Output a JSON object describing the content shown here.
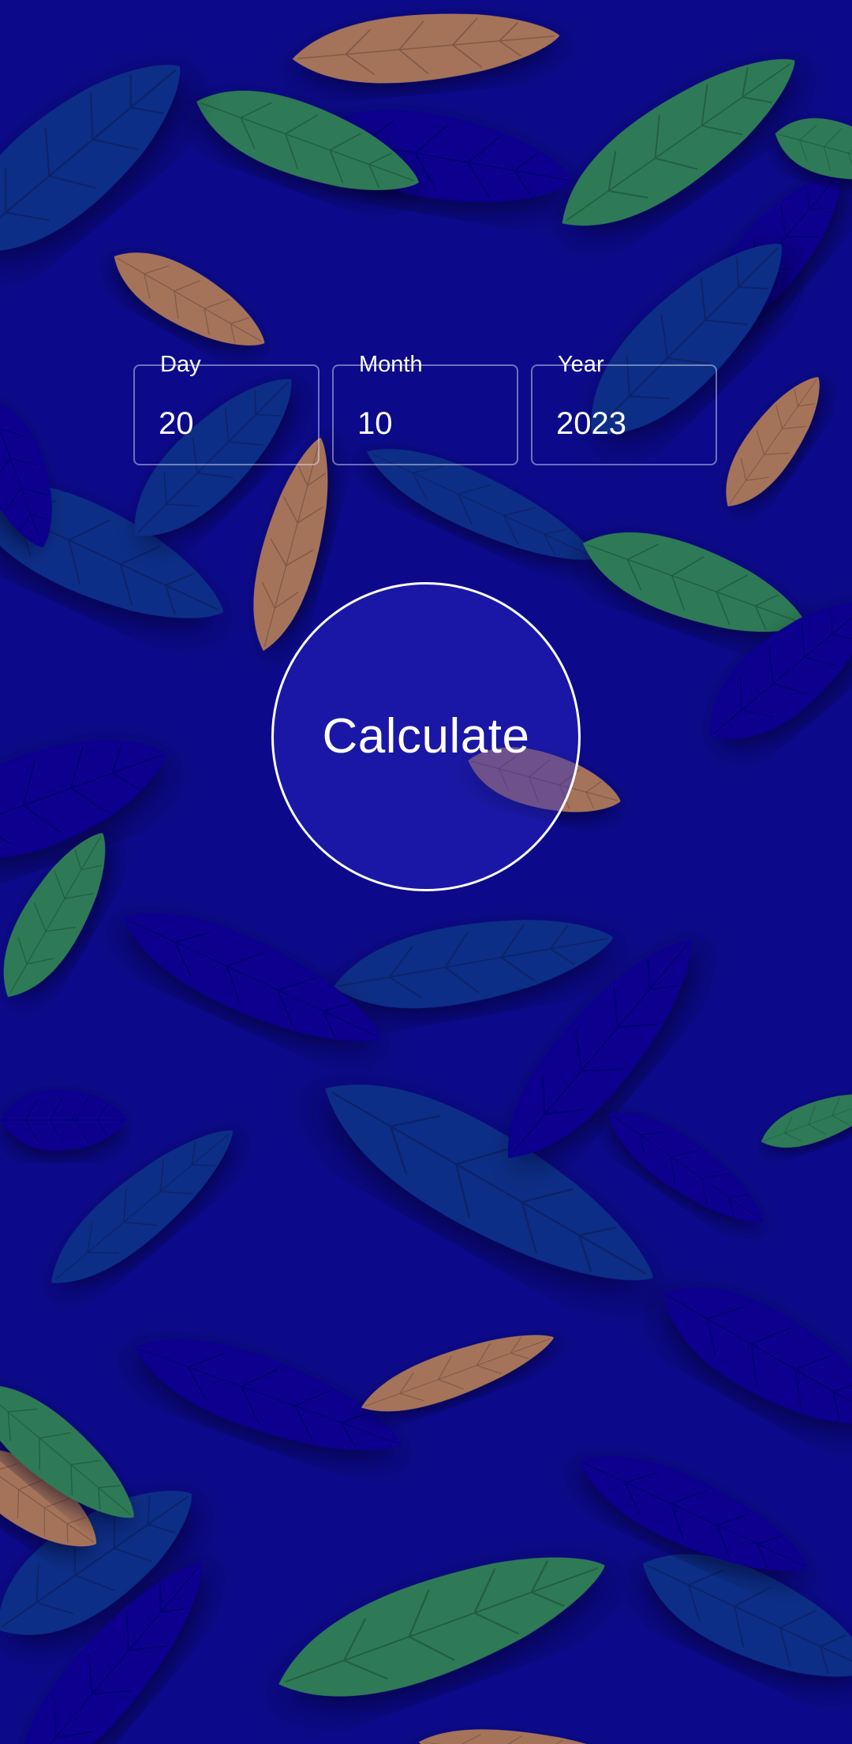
{
  "fields": {
    "day": {
      "label": "Day",
      "value": "20"
    },
    "month": {
      "label": "Month",
      "value": "10"
    },
    "year": {
      "label": "Year",
      "value": "2023"
    }
  },
  "calculate_button": {
    "label": "Calculate"
  },
  "colors": {
    "background": "#0c0a8a",
    "leaf_navy": "#07038f",
    "leaf_blue": "#0f2e86",
    "leaf_green": "#2d7a57",
    "leaf_tan": "#a5735a",
    "button_fill": "#2d28c8",
    "text": "#ffffff"
  },
  "background": {
    "pattern": "leaf-pattern"
  }
}
